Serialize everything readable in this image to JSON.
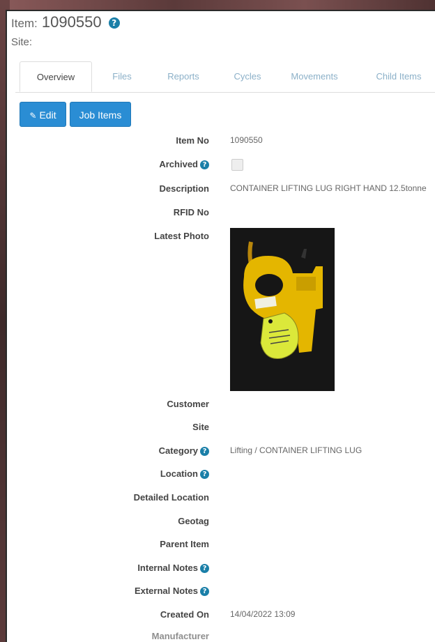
{
  "header": {
    "item_label": "Item:",
    "item_number": "1090550",
    "site_label": "Site:"
  },
  "tabs": [
    {
      "label": "Overview",
      "active": true
    },
    {
      "label": "Files",
      "active": false
    },
    {
      "label": "Reports",
      "active": false
    },
    {
      "label": "Cycles",
      "active": false
    },
    {
      "label": "Movements",
      "active": false
    },
    {
      "label": "Child Items",
      "active": false
    }
  ],
  "buttons": {
    "edit": "Edit",
    "job_items": "Job Items"
  },
  "fields": {
    "item_no": {
      "label": "Item No",
      "value": "1090550"
    },
    "archived": {
      "label": "Archived",
      "checked": false
    },
    "description": {
      "label": "Description",
      "value": "CONTAINER LIFTING LUG RIGHT HAND 12.5tonne"
    },
    "rfid_no": {
      "label": "RFID No",
      "value": ""
    },
    "latest_photo": {
      "label": "Latest Photo"
    },
    "customer": {
      "label": "Customer",
      "value": ""
    },
    "site": {
      "label": "Site",
      "value": ""
    },
    "category": {
      "label": "Category",
      "value": "Lifting / CONTAINER LIFTING LUG"
    },
    "location": {
      "label": "Location",
      "value": ""
    },
    "detailed_location": {
      "label": "Detailed Location",
      "value": ""
    },
    "geotag": {
      "label": "Geotag",
      "value": ""
    },
    "parent_item": {
      "label": "Parent Item",
      "value": ""
    },
    "internal_notes": {
      "label": "Internal Notes",
      "value": ""
    },
    "external_notes": {
      "label": "External Notes",
      "value": ""
    },
    "created_on": {
      "label": "Created On",
      "value": "14/04/2022 13:09"
    },
    "manufacturer": {
      "label": "Manufacturer",
      "value": ""
    }
  },
  "icons": {
    "help": "question-circle-icon",
    "edit": "pencil-icon"
  },
  "colors": {
    "primary_button": "#2a8dd4",
    "help_icon": "#1a7fa8",
    "inactive_tab": "#8bb0c8"
  }
}
